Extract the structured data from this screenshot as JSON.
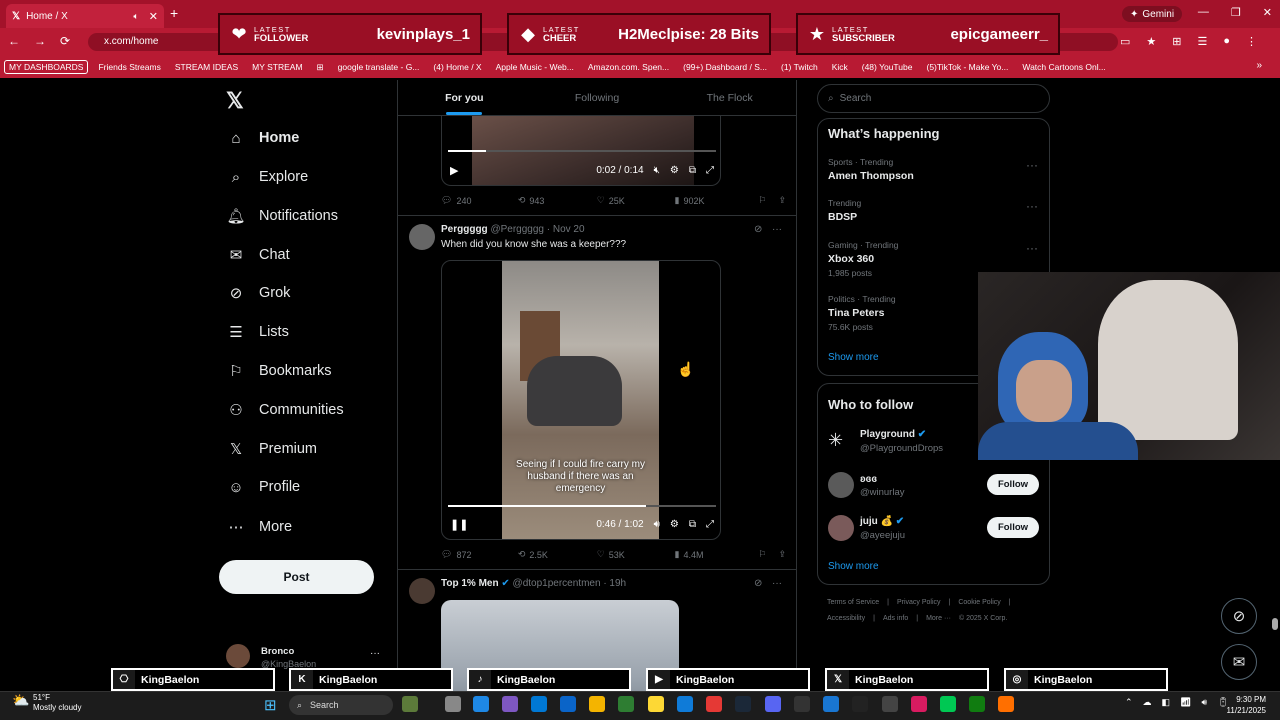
{
  "browser": {
    "tab_title": "Home / X",
    "tab_close": "✕",
    "new_tab": "+",
    "gemini_label": "Gemini",
    "url": "x.com/home",
    "window_controls": [
      "—",
      "❐",
      "✕"
    ],
    "nav_buttons": [
      "←",
      "→",
      "⟳"
    ],
    "right_icons": [
      "▭",
      "★",
      "⊞",
      "☰",
      "●",
      "⋮"
    ],
    "bookmarks": [
      {
        "label": "MY DASHBOARDS",
        "boxed": true
      },
      {
        "label": "Friends Streams",
        "boxed": false
      },
      {
        "label": "STREAM IDEAS",
        "boxed": false
      },
      {
        "label": "MY STREAM",
        "boxed": false
      },
      {
        "label": "⊞",
        "boxed": false
      },
      {
        "label": "google translate - G...",
        "boxed": false
      },
      {
        "label": "(4) Home / X",
        "boxed": false
      },
      {
        "label": "Apple Music - Web...",
        "boxed": false
      },
      {
        "label": "Amazon.com. Spen...",
        "boxed": false
      },
      {
        "label": "(99+) Dashboard / S...",
        "boxed": false
      },
      {
        "label": "(1) Twitch",
        "boxed": false
      },
      {
        "label": "Kick",
        "boxed": false
      },
      {
        "label": "(48) YouTube",
        "boxed": false
      },
      {
        "label": "(5)TikTok - Make Yo...",
        "boxed": false
      },
      {
        "label": "Watch Cartoons Onl...",
        "boxed": false
      }
    ],
    "bookmarks_more": "»"
  },
  "alerts": [
    {
      "icon": "heart-icon",
      "glyph": "❤",
      "kicker": "LATEST",
      "label": "FOLLOWER",
      "value": "kevinplays_1"
    },
    {
      "icon": "diamond-icon",
      "glyph": "◆",
      "kicker": "LATEST",
      "label": "CHEER",
      "value": "H2Meclpise: 28 Bits"
    },
    {
      "icon": "star-icon",
      "glyph": "★",
      "kicker": "LATEST",
      "label": "SUBSCRIBER",
      "value": "epicgameerr_"
    }
  ],
  "nav": {
    "logo": "𝕏",
    "items": [
      {
        "label": "Home",
        "icon": "home-icon",
        "glyph": "⌂",
        "bold": true
      },
      {
        "label": "Explore",
        "icon": "search-icon",
        "glyph": "⌕"
      },
      {
        "label": "Notifications",
        "icon": "bell-icon",
        "glyph": "🔔︎"
      },
      {
        "label": "Chat",
        "icon": "mail-icon",
        "glyph": "✉"
      },
      {
        "label": "Grok",
        "icon": "grok-icon",
        "glyph": "⊘"
      },
      {
        "label": "Lists",
        "icon": "list-icon",
        "glyph": "☰"
      },
      {
        "label": "Bookmarks",
        "icon": "bookmark-icon",
        "glyph": "⚐"
      },
      {
        "label": "Communities",
        "icon": "people-icon",
        "glyph": "⚇"
      },
      {
        "label": "Premium",
        "icon": "x-premium-icon",
        "glyph": "𝕏"
      },
      {
        "label": "Profile",
        "icon": "person-icon",
        "glyph": "☺"
      },
      {
        "label": "More",
        "icon": "more-circle-icon",
        "glyph": "⋯"
      }
    ],
    "post_label": "Post",
    "profile_name": "Bronco",
    "profile_handle": "@KingBaelon",
    "profile_more": "···"
  },
  "feed": {
    "tabs": [
      {
        "label": "For you",
        "active": true
      },
      {
        "label": "Following",
        "active": false
      },
      {
        "label": "The Flock",
        "active": false
      }
    ],
    "tweet1": {
      "time": "0:02 / 0:14",
      "progress": 0.14,
      "replies": "240",
      "reposts": "943",
      "likes": "25K",
      "views": "902K"
    },
    "tweet2": {
      "name": "Perggggg",
      "handle": "@Perggggg",
      "date": "· Nov 20",
      "text": "When did you know she was a keeper???",
      "caption": "Seeing if I could fire carry my husband if there was an emergency",
      "time": "0:46 / 1:02",
      "progress": 0.74,
      "replies": "872",
      "reposts": "2.5K",
      "likes": "53K",
      "views": "4.4M"
    },
    "tweet3": {
      "name": "Top 1% Men",
      "handle": "@dtop1percentmen",
      "date": "· 19h"
    }
  },
  "sidebar": {
    "search_placeholder": "Search",
    "happening_title": "What’s happening",
    "trends": [
      {
        "meta": "Sports · Trending",
        "name": "Amen Thompson",
        "posts": ""
      },
      {
        "meta": "Trending",
        "name": "BDSP",
        "posts": ""
      },
      {
        "meta": "Gaming · Trending",
        "name": "Xbox 360",
        "posts": "1,985 posts"
      },
      {
        "meta": "Politics · Trending",
        "name": "Tina Peters",
        "posts": "75.6K posts"
      }
    ],
    "show_more": "Show more",
    "who_title": "Who to follow",
    "follow": [
      {
        "name": "Playground",
        "handle": "@PlaygroundDrops",
        "verified": true,
        "button": ""
      },
      {
        "name": "ʚɞɞ",
        "handle": "@winurlay",
        "verified": false,
        "button": "Follow"
      },
      {
        "name": "juju 💰",
        "handle": "@ayeejuju",
        "verified": true,
        "button": "Follow"
      }
    ],
    "show_more2": "Show more",
    "footer1": [
      "Terms of Service",
      "|",
      "Privacy Policy",
      "|",
      "Cookie Policy",
      "|"
    ],
    "footer2": [
      "Accessibility",
      "|",
      "Ads info",
      "|",
      "More ···",
      "© 2025 X Corp."
    ]
  },
  "socials": [
    {
      "icon": "twitch-icon",
      "glyph": "⎔",
      "name": "KingBaelon"
    },
    {
      "icon": "kick-icon",
      "glyph": "K",
      "name": "KingBaelon"
    },
    {
      "icon": "tiktok-icon",
      "glyph": "♪",
      "name": "KingBaelon"
    },
    {
      "icon": "youtube-icon",
      "glyph": "▶",
      "name": "KingBaelon"
    },
    {
      "icon": "x-icon",
      "glyph": "𝕏",
      "name": "KingBaelon"
    },
    {
      "icon": "instagram-icon",
      "glyph": "◎",
      "name": "KingBaelon"
    }
  ],
  "taskbar": {
    "temp": "51°F",
    "weather": "Mostly cloudy",
    "search": "Search",
    "time": "9:30 PM",
    "date": "11/21/2025",
    "tray": [
      "⌃",
      "☁",
      "◧",
      "📶︎",
      "🔊︎",
      "🔋︎"
    ]
  },
  "colors": {
    "accent": "#1d9bf0",
    "brand_red": "#a3122a"
  }
}
